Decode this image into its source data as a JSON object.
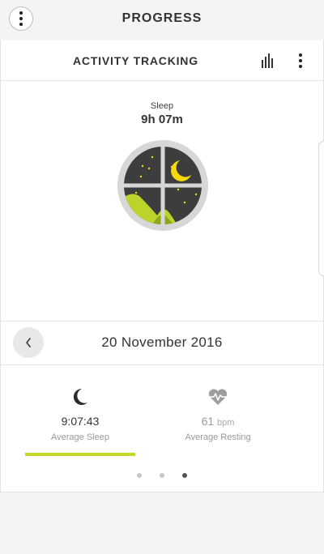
{
  "header": {
    "title": "PROGRESS"
  },
  "card": {
    "title": "ACTIVITY TRACKING"
  },
  "sleep": {
    "label": "Sleep",
    "duration": "9h 07m"
  },
  "date": {
    "text": "20 November 2016"
  },
  "stats": [
    {
      "value": "9:07:43",
      "caption": "Average Sleep",
      "icon": "moon-icon"
    },
    {
      "value": "61",
      "unit": "bpm",
      "caption": "Average Resting",
      "icon": "heart-rate-icon"
    }
  ],
  "pager": {
    "count": 3,
    "active_index": 2
  },
  "colors": {
    "accent": "#c6d92a",
    "moon": "#f5d90a",
    "window_bg": "#3d3d3d"
  }
}
